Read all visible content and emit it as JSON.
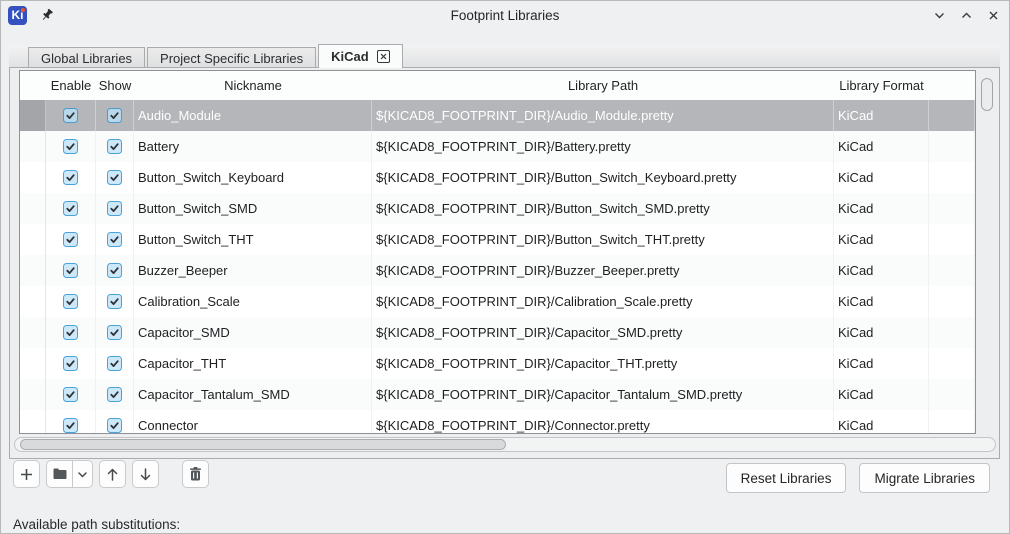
{
  "window": {
    "title": "Footprint Libraries"
  },
  "tabs": [
    {
      "label": "Global Libraries",
      "active": false
    },
    {
      "label": "Project Specific Libraries",
      "active": false
    },
    {
      "label": "KiCad",
      "active": true,
      "closable": true
    }
  ],
  "table": {
    "columns": [
      "Enable",
      "Show",
      "Nickname",
      "Library Path",
      "Library Format"
    ],
    "rows": [
      {
        "enable": true,
        "show": true,
        "nickname": "Audio_Module",
        "path": "${KICAD8_FOOTPRINT_DIR}/Audio_Module.pretty",
        "format": "KiCad",
        "selected": true
      },
      {
        "enable": true,
        "show": true,
        "nickname": "Battery",
        "path": "${KICAD8_FOOTPRINT_DIR}/Battery.pretty",
        "format": "KiCad",
        "selected": false
      },
      {
        "enable": true,
        "show": true,
        "nickname": "Button_Switch_Keyboard",
        "path": "${KICAD8_FOOTPRINT_DIR}/Button_Switch_Keyboard.pretty",
        "format": "KiCad",
        "selected": false
      },
      {
        "enable": true,
        "show": true,
        "nickname": "Button_Switch_SMD",
        "path": "${KICAD8_FOOTPRINT_DIR}/Button_Switch_SMD.pretty",
        "format": "KiCad",
        "selected": false
      },
      {
        "enable": true,
        "show": true,
        "nickname": "Button_Switch_THT",
        "path": "${KICAD8_FOOTPRINT_DIR}/Button_Switch_THT.pretty",
        "format": "KiCad",
        "selected": false
      },
      {
        "enable": true,
        "show": true,
        "nickname": "Buzzer_Beeper",
        "path": "${KICAD8_FOOTPRINT_DIR}/Buzzer_Beeper.pretty",
        "format": "KiCad",
        "selected": false
      },
      {
        "enable": true,
        "show": true,
        "nickname": "Calibration_Scale",
        "path": "${KICAD8_FOOTPRINT_DIR}/Calibration_Scale.pretty",
        "format": "KiCad",
        "selected": false
      },
      {
        "enable": true,
        "show": true,
        "nickname": "Capacitor_SMD",
        "path": "${KICAD8_FOOTPRINT_DIR}/Capacitor_SMD.pretty",
        "format": "KiCad",
        "selected": false
      },
      {
        "enable": true,
        "show": true,
        "nickname": "Capacitor_THT",
        "path": "${KICAD8_FOOTPRINT_DIR}/Capacitor_THT.pretty",
        "format": "KiCad",
        "selected": false
      },
      {
        "enable": true,
        "show": true,
        "nickname": "Capacitor_Tantalum_SMD",
        "path": "${KICAD8_FOOTPRINT_DIR}/Capacitor_Tantalum_SMD.pretty",
        "format": "KiCad",
        "selected": false
      },
      {
        "enable": true,
        "show": true,
        "nickname": "Connector",
        "path": "${KICAD8_FOOTPRINT_DIR}/Connector.pretty",
        "format": "KiCad",
        "selected": false
      }
    ]
  },
  "toolbar": {
    "icons": [
      "plus-icon",
      "folder-icon",
      "chevron-down-icon",
      "arrow-up-icon",
      "arrow-down-icon",
      "trash-icon"
    ]
  },
  "actions": {
    "reset_label": "Reset Libraries",
    "migrate_label": "Migrate Libraries"
  },
  "footer": {
    "available_paths_label": "Available path substitutions:"
  },
  "colors": {
    "accent_checkbox_border": "#49a3db",
    "accent_checkbox_fill": "#cde8f9",
    "selected_row_bg": "#b5b6ba",
    "kicad_logo_blue": "#3352c0",
    "dialog_bg": "#eff0f1"
  }
}
